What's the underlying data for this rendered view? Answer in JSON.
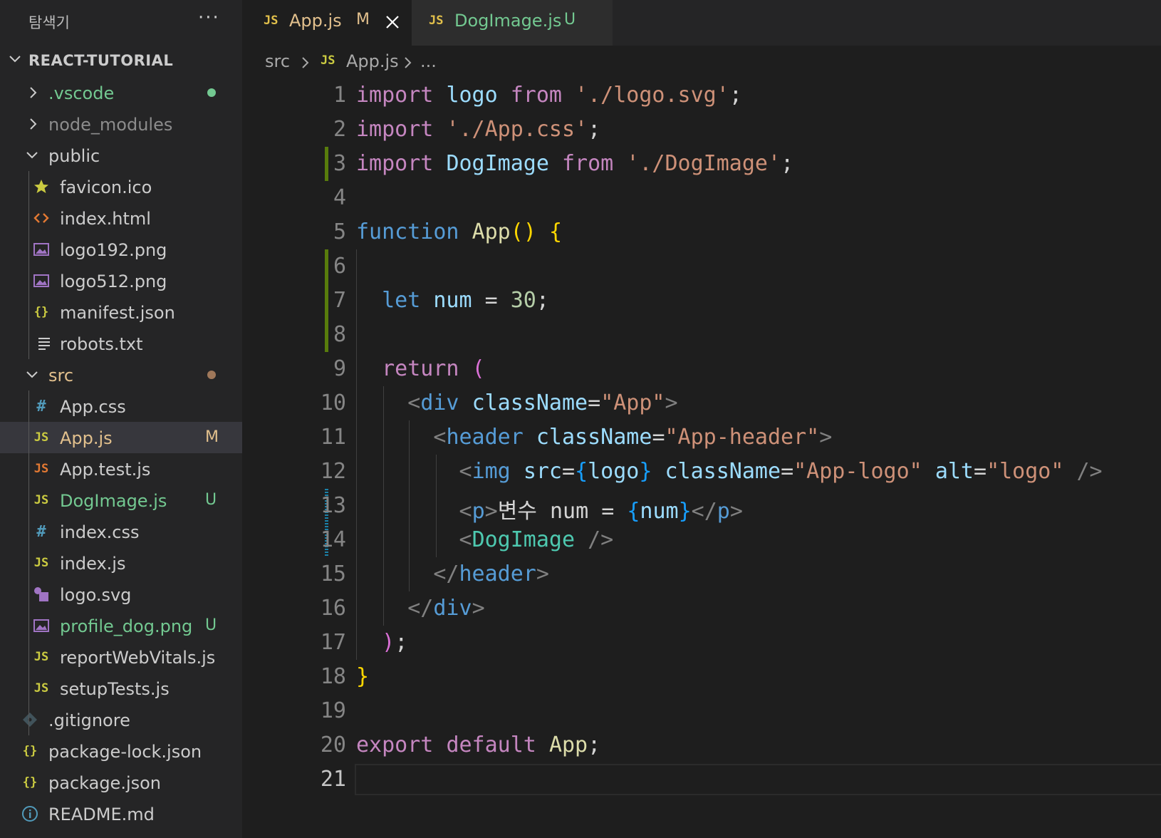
{
  "sidebar": {
    "title": "탐색기",
    "more": "···",
    "root_label": "REACT-TUTORIAL",
    "items": [
      {
        "label": ".vscode",
        "icon": "chevron-right-icon",
        "color": "#73c991",
        "status": "dot"
      },
      {
        "label": "node_modules",
        "icon": "chevron-right-icon",
        "color": "#8c8c8c"
      },
      {
        "label": "public",
        "icon": "chevron-down-icon",
        "color": "#cccccc"
      },
      {
        "label": "favicon.ico",
        "icon": "star-icon",
        "color": "#cccccc"
      },
      {
        "label": "index.html",
        "icon": "html-icon",
        "color": "#cccccc"
      },
      {
        "label": "logo192.png",
        "icon": "image-icon",
        "color": "#cccccc"
      },
      {
        "label": "logo512.png",
        "icon": "image-icon",
        "color": "#cccccc"
      },
      {
        "label": "manifest.json",
        "icon": "json-icon",
        "color": "#cccccc"
      },
      {
        "label": "robots.txt",
        "icon": "text-file-icon",
        "color": "#cccccc"
      },
      {
        "label": "src",
        "icon": "chevron-down-icon",
        "color": "#e2c08d",
        "status": "dot"
      },
      {
        "label": "App.css",
        "icon": "css-icon",
        "color": "#cccccc"
      },
      {
        "label": "App.js",
        "icon": "js-icon",
        "color": "#e2c08d",
        "badge": "M"
      },
      {
        "label": "App.test.js",
        "icon": "js-test-icon",
        "color": "#cccccc"
      },
      {
        "label": "DogImage.js",
        "icon": "js-icon",
        "color": "#73c991",
        "badge": "U"
      },
      {
        "label": "index.css",
        "icon": "css-icon",
        "color": "#cccccc"
      },
      {
        "label": "index.js",
        "icon": "js-icon",
        "color": "#cccccc"
      },
      {
        "label": "logo.svg",
        "icon": "svg-icon",
        "color": "#cccccc"
      },
      {
        "label": "profile_dog.png",
        "icon": "image-icon",
        "color": "#73c991",
        "badge": "U"
      },
      {
        "label": "reportWebVitals.js",
        "icon": "js-icon",
        "color": "#cccccc"
      },
      {
        "label": "setupTests.js",
        "icon": "js-icon",
        "color": "#cccccc"
      },
      {
        "label": ".gitignore",
        "icon": "git-icon",
        "color": "#cccccc"
      },
      {
        "label": "package-lock.json",
        "icon": "json-icon",
        "color": "#cccccc"
      },
      {
        "label": "package.json",
        "icon": "json-icon",
        "color": "#cccccc"
      },
      {
        "label": "README.md",
        "icon": "info-icon",
        "color": "#cccccc"
      }
    ]
  },
  "tabs": [
    {
      "icon_text": "JS",
      "label": "App.js",
      "badge": "M"
    },
    {
      "icon_text": "JS",
      "label": "DogImage.js",
      "badge": "U"
    }
  ],
  "breadcrumb": {
    "folder": "src",
    "icon_text": "JS",
    "file": "App.js",
    "rest": "..."
  },
  "editor": {
    "line_numbers": [
      "1",
      "2",
      "3",
      "4",
      "5",
      "6",
      "7",
      "8",
      "9",
      "10",
      "11",
      "12",
      "13",
      "14",
      "15",
      "16",
      "17",
      "18",
      "19",
      "20",
      "21"
    ],
    "code": {
      "l1": [
        "import",
        " ",
        "logo",
        " ",
        "from",
        " ",
        "'./logo.svg'",
        ";"
      ],
      "l2": [
        "import",
        " ",
        "'./App.css'",
        ";"
      ],
      "l3": [
        "import",
        " ",
        "DogImage",
        " ",
        "from",
        " ",
        "'./DogImage'",
        ";"
      ],
      "l5": [
        "function",
        " ",
        "App",
        "(",
        ")",
        " ",
        "{"
      ],
      "l7": [
        "let",
        " ",
        "num",
        " = ",
        "30",
        ";"
      ],
      "l9": [
        "return",
        " ",
        "("
      ],
      "l10": [
        "<",
        "div",
        " ",
        "className",
        "=",
        "\"App\"",
        ">"
      ],
      "l11": [
        "<",
        "header",
        " ",
        "className",
        "=",
        "\"App-header\"",
        ">"
      ],
      "l12": [
        "<",
        "img",
        " ",
        "src",
        "=",
        "{",
        "logo",
        "}",
        " ",
        "className",
        "=",
        "\"App-logo\"",
        " ",
        "alt",
        "=",
        "\"logo\"",
        " ",
        "/>"
      ],
      "l13": [
        "<",
        "p",
        ">",
        "변수 num = ",
        "{",
        "num",
        "}",
        "</",
        "p",
        ">"
      ],
      "l14": [
        "<",
        "DogImage",
        " ",
        "/>"
      ],
      "l15": [
        "</",
        "header",
        ">"
      ],
      "l16": [
        "</",
        "div",
        ">"
      ],
      "l17": [
        ")",
        ";"
      ],
      "l18": [
        "}"
      ],
      "l20": [
        "export",
        " ",
        "default",
        " ",
        "App",
        ";"
      ]
    }
  },
  "colors": {
    "modified_green": "#73c991",
    "modified_amber": "#e2c08d",
    "gutter_added": "#587c0c",
    "gutter_modified": "#1b81a8"
  }
}
